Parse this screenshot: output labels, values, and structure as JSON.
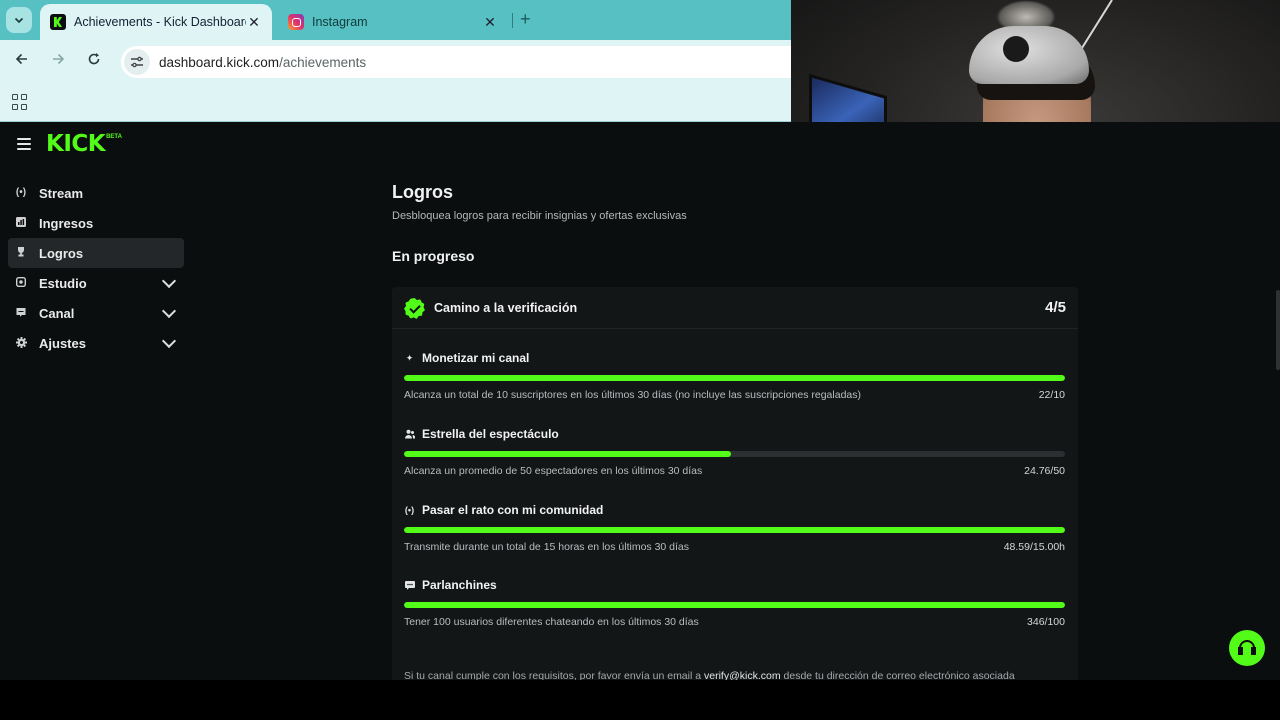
{
  "browser": {
    "tabs": [
      {
        "title": "Achievements - Kick Dashboard",
        "active": true,
        "favicon": "kick-favicon"
      },
      {
        "title": "Instagram",
        "active": false,
        "favicon": "instagram-favicon"
      }
    ],
    "url_domain": "dashboard.kick.com",
    "url_path": "/achievements",
    "close_glyph": "✕",
    "new_tab_glyph": "+"
  },
  "brand": {
    "logo": "KICK",
    "badge": "BETA",
    "accent": "#53fc18"
  },
  "sidebar": {
    "items": [
      {
        "label": "Stream",
        "icon": "broadcast-icon",
        "active": false,
        "expandable": false
      },
      {
        "label": "Ingresos",
        "icon": "chart-icon",
        "active": false,
        "expandable": false
      },
      {
        "label": "Logros",
        "icon": "trophy-icon",
        "active": true,
        "expandable": false
      },
      {
        "label": "Estudio",
        "icon": "studio-icon",
        "active": false,
        "expandable": true
      },
      {
        "label": "Canal",
        "icon": "channel-icon",
        "active": false,
        "expandable": true
      },
      {
        "label": "Ajustes",
        "icon": "gear-icon",
        "active": false,
        "expandable": true
      }
    ]
  },
  "page": {
    "title": "Logros",
    "subtitle": "Desbloquea logros para recibir insignias y ofertas exclusivas",
    "section": "En progreso"
  },
  "achievement": {
    "title": "Camino a la verificación",
    "count": "4/5",
    "tasks": [
      {
        "title": "Monetizar mi canal",
        "icon": "sparkle-icon",
        "desc": "Alcanza un total de 10 suscriptores en los últimos 30 días (no incluye las suscripciones regaladas)",
        "value": "22/10",
        "progress": 1.0
      },
      {
        "title": "Estrella del espectáculo",
        "icon": "viewers-icon",
        "desc": "Alcanza un promedio de 50 espectadores en los últimos 30 días",
        "value": "24.76/50",
        "progress": 0.4952
      },
      {
        "title": "Pasar el rato con mi comunidad",
        "icon": "broadcast-icon",
        "desc": "Transmite durante un total de 15 horas en los últimos 30 días",
        "value": "48.59/15.00h",
        "progress": 1.0
      },
      {
        "title": "Parlanchines",
        "icon": "chat-icon",
        "desc": "Tener 100 usuarios diferentes chateando en los últimos 30 días",
        "value": "346/100",
        "progress": 1.0
      }
    ],
    "footer_prefix": "Si tu canal cumple con los requisitos, por favor envía un email a",
    "footer_email": "verify@kick.com",
    "footer_suffix": "desde tu dirección de correo electrónico asociada"
  }
}
